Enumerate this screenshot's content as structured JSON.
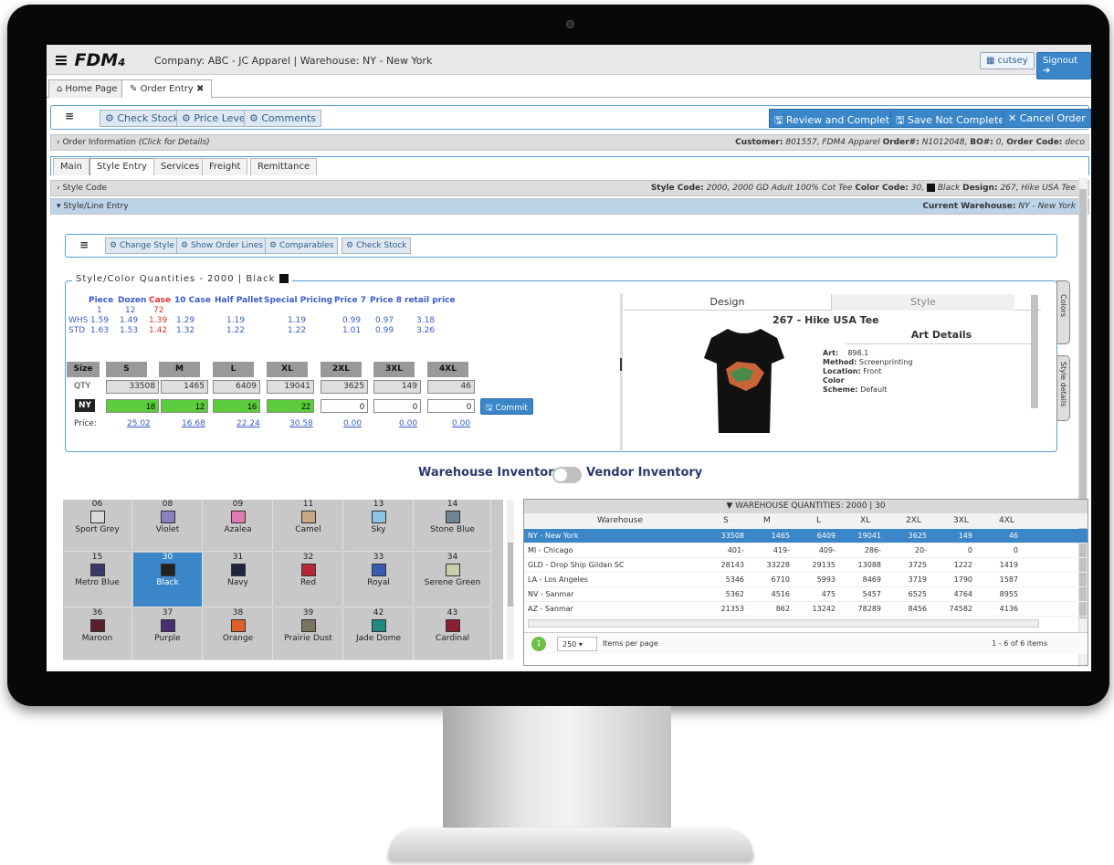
{
  "app": {
    "logo": "≡ FDM₄",
    "company_line": "Company: ABC - JC Apparel  |  Warehouse: NY - New York",
    "user": "cutsey",
    "signout": "Signout"
  },
  "tabs": [
    {
      "label": "Home Page",
      "icon": "home-icon"
    },
    {
      "label": "Order Entry",
      "icon": "pin-icon"
    }
  ],
  "toolbar": {
    "menu": "≡",
    "check_stock": "Check Stock",
    "price_level": "Price Level",
    "comments": "Comments",
    "review": "Review and Complete",
    "save": "Save Not Complete",
    "cancel": "Cancel Order"
  },
  "order_info": {
    "label": "Order Information",
    "hint": "(Click for Details)",
    "customer_label": "Customer:",
    "customer": "801557, FDM4 Apparel",
    "order_label": "Order#:",
    "order": "N1012048,",
    "bo_label": "BO#:",
    "bo": "0,",
    "code_label": "Order Code:",
    "code": "deco"
  },
  "subtabs": [
    "Main",
    "Style Entry",
    "Services",
    "Freight",
    "Remittance"
  ],
  "style_code_bar": {
    "label": "Style Code",
    "style_label": "Style Code:",
    "style": "2000, 2000 GD Adult 100% Cot Tee",
    "color_label": "Color Code:",
    "color": "30,",
    "color_name": "Black",
    "design_label": "Design:",
    "design": "267, Hike USA Tee"
  },
  "line_bar": {
    "label": "Style/Line Entry",
    "wh_label": "Current Warehouse:",
    "wh": "NY - New York"
  },
  "line_toolbar": {
    "menu": "≡",
    "change_style": "Change Style",
    "show_lines": "Show Order Lines",
    "comparables": "Comparables",
    "check_stock": "Check Stock"
  },
  "quantities": {
    "legend": "Style/Color Quantities - 2000 | Black",
    "price_headers": [
      "Piece",
      "Dozen",
      "Case",
      "10 Case",
      "Half Pallet",
      "Special Pricing",
      "Price 7",
      "Price 8",
      "retail price"
    ],
    "units": [
      "1",
      "12",
      "72"
    ],
    "whs_label": "WHS",
    "whs": [
      "1.59",
      "1.49",
      "1.39",
      "1.29",
      "1.19",
      "1.19",
      "0.99",
      "0.97",
      "3.18"
    ],
    "std_label": "STD",
    "std": [
      "1.63",
      "1.53",
      "1.42",
      "1.32",
      "1.22",
      "1.22",
      "1.01",
      "0.99",
      "3.26"
    ],
    "size_label": "Size",
    "sizes": [
      "S",
      "M",
      "L",
      "XL",
      "2XL",
      "3XL",
      "4XL"
    ],
    "qty_label": "QTY",
    "qty": [
      "33508",
      "1465",
      "6409",
      "19041",
      "3625",
      "149",
      "46"
    ],
    "ny_label": "NY",
    "ny": [
      "18",
      "12",
      "16",
      "22",
      "0",
      "0",
      "0"
    ],
    "price_label": "Price:",
    "prices": [
      "25.02",
      "16.68",
      "22.24",
      "30.58",
      "0.00",
      "0.00",
      "0.00"
    ],
    "commit": "Commit"
  },
  "design_panel": {
    "tab_design": "Design",
    "tab_style": "Style",
    "title": "267 - Hike USA Tee",
    "art_title": "Art Details",
    "art_label": "Art:",
    "art": "898.1",
    "method_label": "Method:",
    "method": "Screenprinting",
    "location_label": "Location:",
    "location": "Front",
    "color_label": "Color",
    "scheme_label": "Scheme:",
    "scheme": "Default",
    "side_colors": "Colors",
    "side_style": "Style details"
  },
  "inventory_toggle": {
    "warehouse": "Warehouse Inventory",
    "vendor": "Vendor Inventory"
  },
  "swatches": [
    {
      "code": "06",
      "name": "Sport Grey",
      "color": "#d9d9d9"
    },
    {
      "code": "08",
      "name": "Violet",
      "color": "#8a7fc0"
    },
    {
      "code": "09",
      "name": "Azalea",
      "color": "#e07ab0"
    },
    {
      "code": "11",
      "name": "Camel",
      "color": "#c8a882"
    },
    {
      "code": "13",
      "name": "Sky",
      "color": "#8ec3e6"
    },
    {
      "code": "14",
      "name": "Stone Blue",
      "color": "#6d8595"
    },
    {
      "code": "15",
      "name": "Metro Blue",
      "color": "#3a3a6a"
    },
    {
      "code": "30",
      "name": "Black",
      "color": "#222222"
    },
    {
      "code": "31",
      "name": "Navy",
      "color": "#1e2340"
    },
    {
      "code": "32",
      "name": "Red",
      "color": "#b5283a"
    },
    {
      "code": "33",
      "name": "Royal",
      "color": "#3a5bb0"
    },
    {
      "code": "34",
      "name": "Serene Green",
      "color": "#c8ceaa"
    },
    {
      "code": "36",
      "name": "Maroon",
      "color": "#5a1f2a"
    },
    {
      "code": "37",
      "name": "Purple",
      "color": "#4a2f70"
    },
    {
      "code": "38",
      "name": "Orange",
      "color": "#e0602a"
    },
    {
      "code": "39",
      "name": "Prairie Dust",
      "color": "#7a7560"
    },
    {
      "code": "42",
      "name": "Jade Dome",
      "color": "#1f8a80"
    },
    {
      "code": "43",
      "name": "Cardinal",
      "color": "#8a2030"
    }
  ],
  "warehouse_table": {
    "title": "WAREHOUSE QUANTITIES: 2000 | 30",
    "headers": [
      "Warehouse",
      "S",
      "M",
      "L",
      "XL",
      "2XL",
      "3XL",
      "4XL"
    ],
    "rows": [
      [
        "NY - New York",
        "33508",
        "1465",
        "6409",
        "19041",
        "3625",
        "149",
        "46"
      ],
      [
        "MI - Chicago",
        "401-",
        "419-",
        "409-",
        "286-",
        "20-",
        "0",
        "0"
      ],
      [
        "GLD - Drop Ship Gildan SC",
        "28143",
        "33228",
        "29135",
        "13088",
        "3725",
        "1222",
        "1419"
      ],
      [
        "LA - Los Angeles",
        "5346",
        "6710",
        "5993",
        "8469",
        "3719",
        "1790",
        "1587"
      ],
      [
        "NV - Sanmar",
        "5362",
        "4516",
        "475",
        "5457",
        "6525",
        "4764",
        "8955"
      ],
      [
        "AZ - Sanmar",
        "21353",
        "862",
        "13242",
        "78289",
        "8456",
        "74582",
        "4136"
      ]
    ],
    "page": "1",
    "per_page": "250",
    "per_page_label": "Items per page",
    "summary": "1 - 6 of 6 items"
  }
}
